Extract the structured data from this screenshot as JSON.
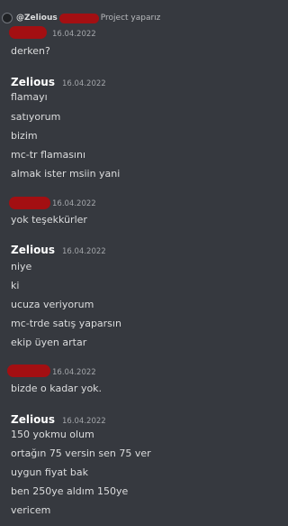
{
  "reply": {
    "mention": "@Zelious",
    "preview": "Project yaparız"
  },
  "groups": [
    {
      "author": "",
      "timestamp": "16.04.2022",
      "lines": [
        "derken?"
      ]
    },
    {
      "author": "Zelious",
      "timestamp": "16.04.2022",
      "lines": [
        "flamayı",
        "satıyorum",
        "bizim",
        "mc-tr flamasını",
        "almak ister msiin yani"
      ]
    },
    {
      "author": "",
      "timestamp": "16.04.2022",
      "lines": [
        "yok teşekkürler"
      ]
    },
    {
      "author": "Zelious",
      "timestamp": "16.04.2022",
      "lines": [
        "niye",
        "ki",
        "ucuza veriyorum",
        "mc-trde satış yaparsın",
        "ekip üyen artar"
      ]
    },
    {
      "author": "",
      "timestamp": "16.04.2022",
      "lines": [
        "bizde o kadar yok."
      ]
    },
    {
      "author": "Zelious",
      "timestamp": "16.04.2022",
      "lines": [
        "150 yokmu olum",
        "ortağın 75 versin sen 75 ver",
        "uygun fiyat bak",
        "ben 250ye aldım 150ye",
        "vericem"
      ]
    }
  ],
  "colors": {
    "background": "#36393f",
    "redaction": "#a30f12",
    "author": "#ffffff",
    "text": "#dcddde",
    "timestamp": "#a3a6aa"
  }
}
